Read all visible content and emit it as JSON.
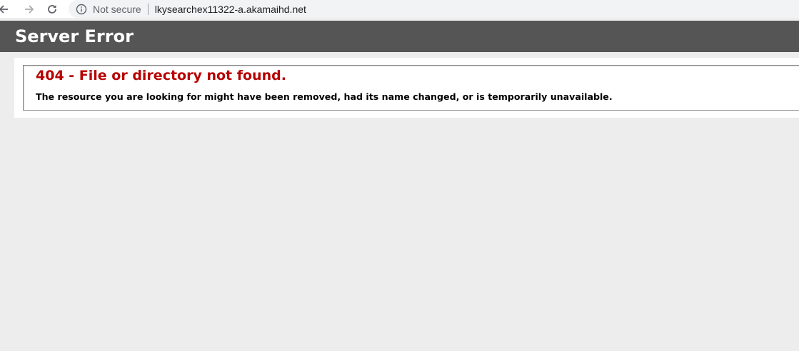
{
  "browser": {
    "back_icon": "arrow-left-icon",
    "forward_icon": "arrow-right-icon",
    "reload_icon": "reload-icon",
    "security_icon": "info-icon",
    "security_label": "Not secure",
    "url": "lkysearchex11322-a.akamaihd.net"
  },
  "page": {
    "header_title": "Server Error",
    "error_title": "404 - File or directory not found.",
    "error_description": "The resource you are looking for might have been removed, had its name changed, or is temporarily unavailable."
  },
  "colors": {
    "header_bg": "#555555",
    "error_title": "#b70000",
    "page_bg": "#ededed"
  }
}
